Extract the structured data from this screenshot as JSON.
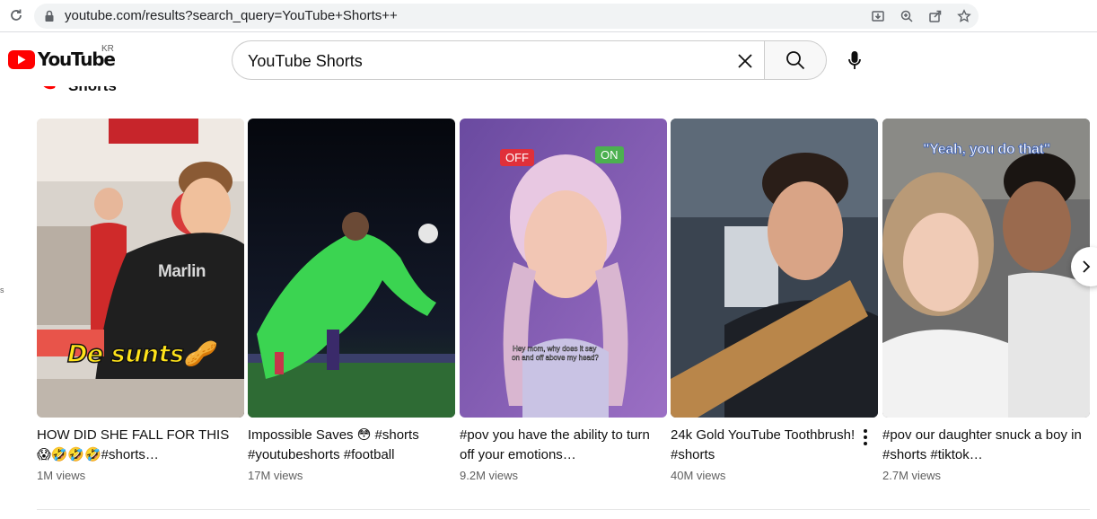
{
  "browser": {
    "url": "youtube.com/results?search_query=YouTube+Shorts++"
  },
  "header": {
    "logo_text": "YouTube",
    "country_code": "KR",
    "search_value": "YouTube Shorts"
  },
  "shelf": {
    "title": "Shorts"
  },
  "sidebar_fragment": "s",
  "shorts": [
    {
      "title": "HOW DID SHE FALL FOR THIS 😱🤣🤣🤣#shorts…",
      "views": "1M views",
      "overlay_text": "De sunts🥜",
      "shirt_text": "Marlin"
    },
    {
      "title": "Impossible Saves 😳 #shorts #youtubeshorts #football",
      "views": "17M views"
    },
    {
      "title": "#pov you have the ability to turn off your emotions…",
      "views": "9.2M views",
      "label_off": "OFF",
      "label_on": "ON",
      "caption_line1": "Hey mom, why does it say",
      "caption_line2": "on and off above my head?"
    },
    {
      "title": "24k Gold YouTube Toothbrush! #shorts",
      "views": "40M views"
    },
    {
      "title": "#pov our daughter snuck a boy in #shorts #tiktok…",
      "views": "2.7M views",
      "overlay_text": "\"Yeah, you do that\""
    }
  ],
  "colors": {
    "brand_red": "#ff0000",
    "text_primary": "#0f0f0f",
    "text_secondary": "#606060",
    "off_label": "#e0303a",
    "on_label": "#4cb050"
  }
}
